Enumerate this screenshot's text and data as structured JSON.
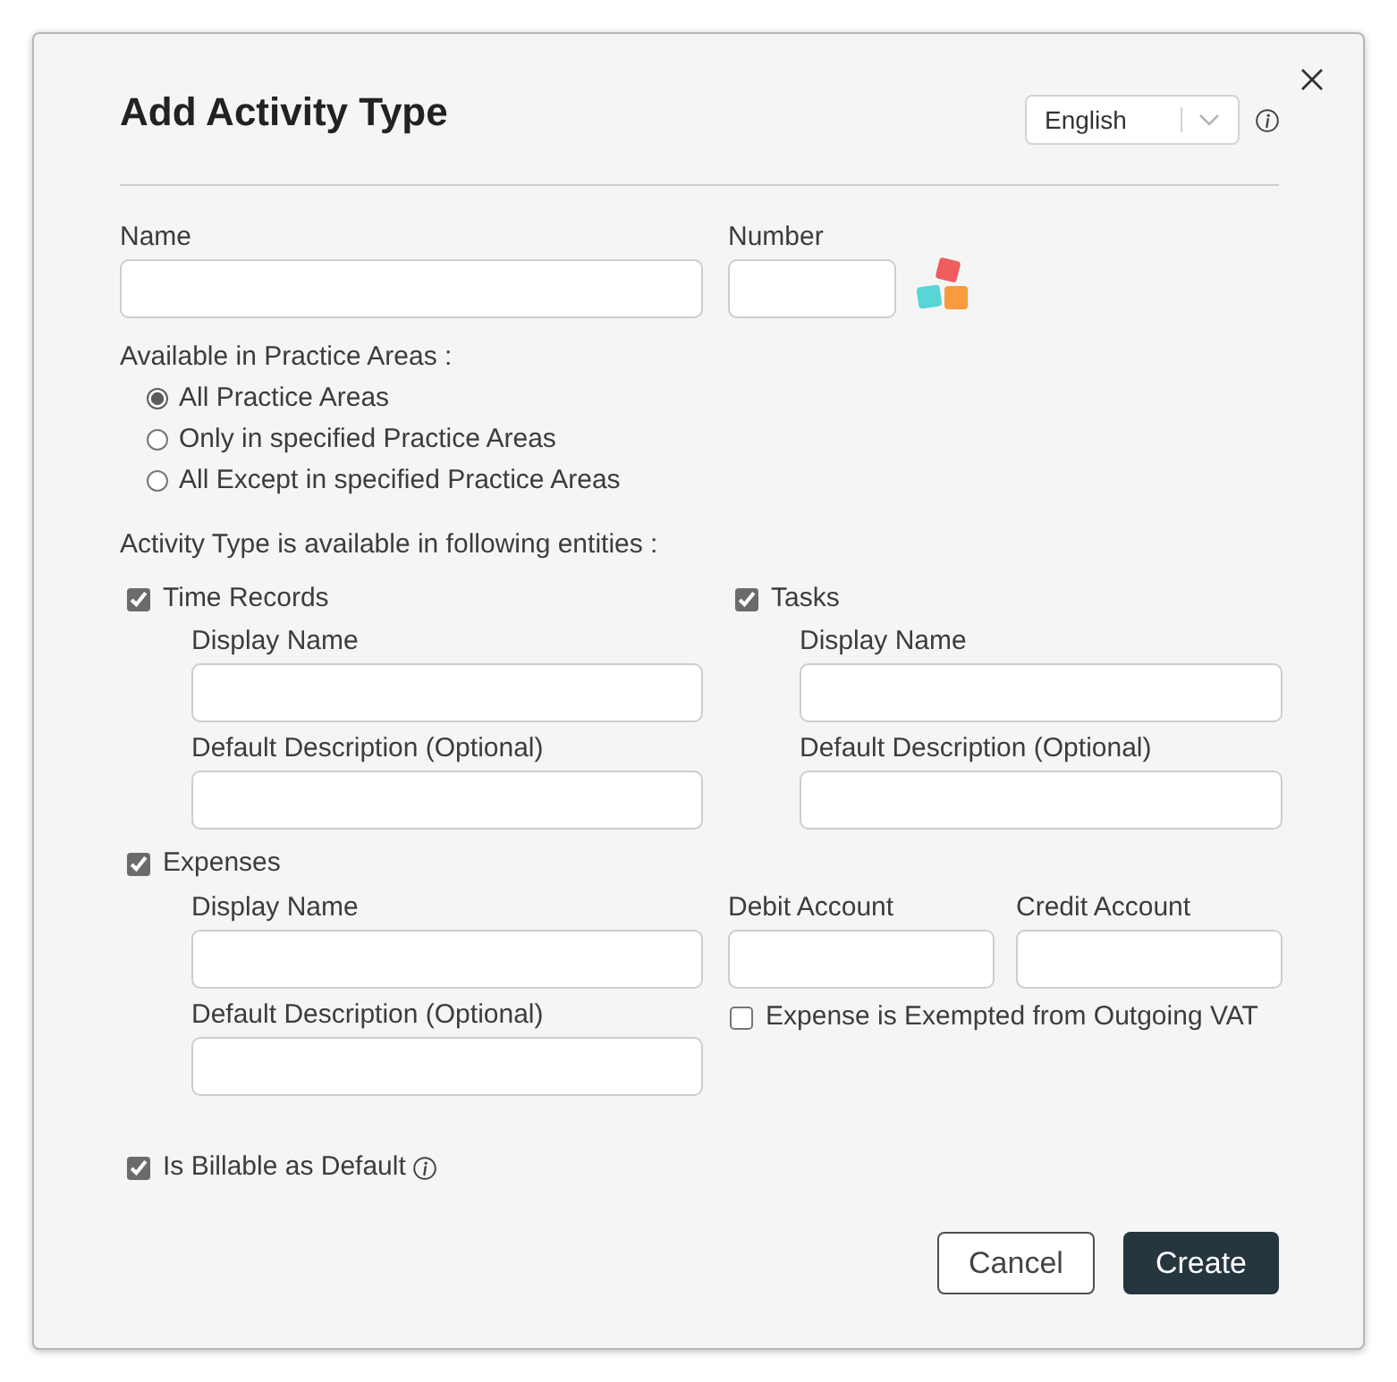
{
  "dialog": {
    "title": "Add Activity Type"
  },
  "language": {
    "value": "English"
  },
  "name": {
    "label": "Name"
  },
  "number": {
    "label": "Number"
  },
  "practice_areas": {
    "label": "Available in Practice Areas :",
    "options": [
      {
        "label": "All Practice Areas",
        "selected": true
      },
      {
        "label": "Only in specified Practice Areas",
        "selected": false
      },
      {
        "label": "All Except in specified Practice Areas",
        "selected": false
      }
    ]
  },
  "entities": {
    "label": "Activity Type is available in following entities :",
    "items": [
      {
        "label": "Time Records",
        "checked": true,
        "fields": [
          {
            "label": "Display Name"
          },
          {
            "label": "Default Description (Optional)"
          }
        ]
      },
      {
        "label": "Tasks",
        "checked": true,
        "fields": [
          {
            "label": "Display Name"
          },
          {
            "label": "Default Description (Optional)"
          }
        ]
      },
      {
        "label": "Expenses",
        "checked": true,
        "fields": [
          {
            "label": "Display Name"
          },
          {
            "label": "Default Description (Optional)"
          }
        ],
        "accounts": [
          {
            "label": "Debit Account"
          },
          {
            "label": "Credit Account"
          }
        ],
        "vat_exempt": {
          "label": "Expense is Exempted from Outgoing VAT",
          "checked": false
        }
      }
    ]
  },
  "billable": {
    "label": "Is Billable as Default",
    "checked": true
  },
  "buttons": [
    {
      "label": "Cancel",
      "kind": "secondary"
    },
    {
      "label": "Create",
      "kind": "primary"
    }
  ]
}
